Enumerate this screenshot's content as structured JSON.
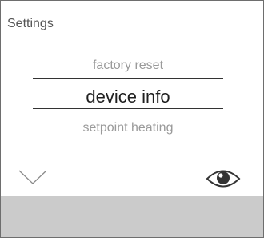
{
  "header": {
    "title": "Settings"
  },
  "menu": {
    "previous_item": "factory reset",
    "selected_item": "device info",
    "next_item": "setpoint heating"
  },
  "controls": {
    "down_icon": "chevron-down-icon",
    "view_icon": "eye-icon"
  },
  "colors": {
    "bottom_bar": "#cbcbcb",
    "selected_text": "#1f1f1f",
    "inactive_text": "#9a9a9a"
  }
}
